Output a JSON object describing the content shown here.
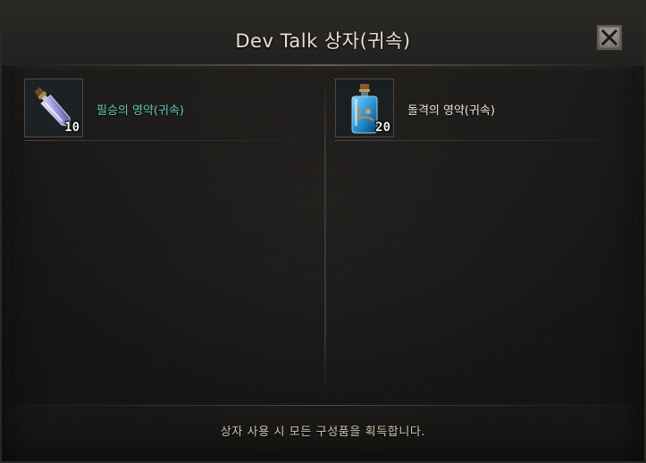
{
  "window": {
    "title": "Dev Talk 상자(귀속)",
    "close_icon": "close-icon"
  },
  "items": [
    {
      "name": "필승의 영약(귀속)",
      "quantity": "10",
      "name_color": "#63c9b8",
      "icon": "vial-potion-icon"
    },
    {
      "name": "돌격의 영약(귀속)",
      "quantity": "20",
      "name_color": "#ece7dc",
      "icon": "blue-bottle-potion-icon"
    }
  ],
  "footer": {
    "text": "상자 사용 시 모든 구성품을 획득합니다."
  }
}
